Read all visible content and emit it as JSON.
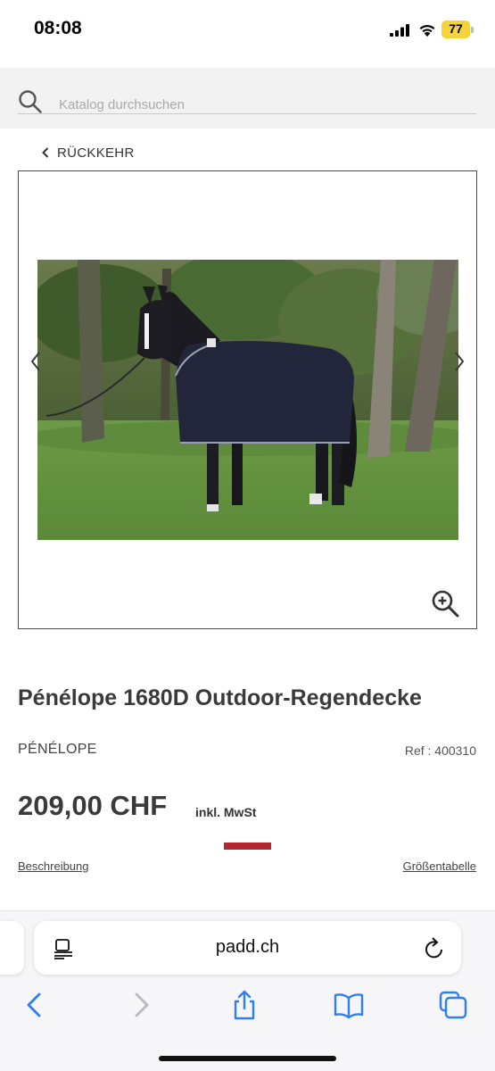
{
  "status_bar": {
    "time": "08:08",
    "battery_level": "77",
    "icons": [
      "signal-icon",
      "wifi-icon",
      "battery-icon"
    ]
  },
  "search": {
    "placeholder": "Katalog durchsuchen",
    "icon": "search-icon"
  },
  "navigation": {
    "back_label": "RÜCKKEHR"
  },
  "product": {
    "title": "Pénélope 1680D Outdoor-Regendecke",
    "brand": "PÉNÉLOPE",
    "reference": "Ref : 400310",
    "price": "209,00 CHF",
    "tax_note": "inkl. MwSt",
    "accent_color": "#b3282f"
  },
  "tabs": {
    "description": "Beschreibung",
    "size_chart": "Größentabelle"
  },
  "browser": {
    "url": "padd.ch",
    "toolbar_icons": [
      "back-icon",
      "forward-icon",
      "share-icon",
      "bookmarks-icon",
      "tabs-icon"
    ]
  }
}
